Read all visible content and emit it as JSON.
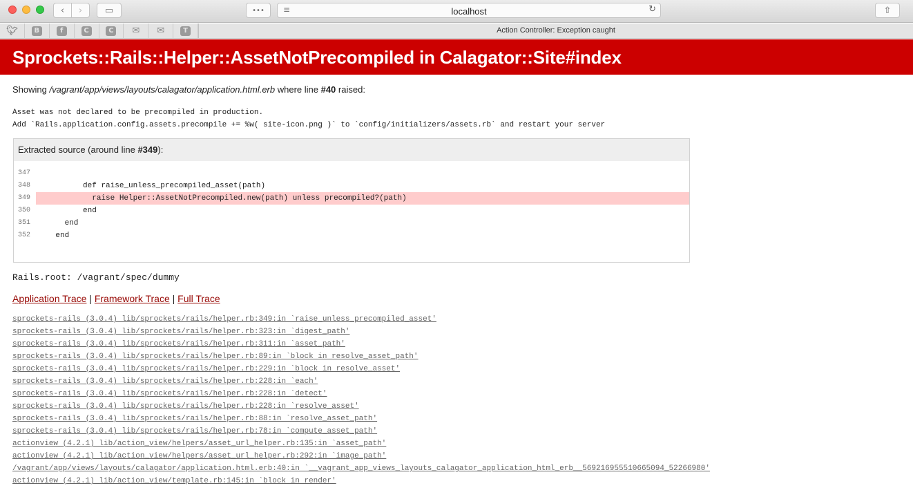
{
  "browser": {
    "address": "localhost",
    "tab_title": "Action Controller: Exception caught",
    "icons": {
      "reader": "≡",
      "reload": "↻",
      "share": "⇧",
      "sidebar": "▭",
      "back": "‹",
      "forward": "›",
      "extensions": "•••"
    },
    "favorites": [
      "twitter",
      "B",
      "f",
      "C",
      "C",
      "mail",
      "mail",
      "T"
    ]
  },
  "error": {
    "title": "Sprockets::Rails::Helper::AssetNotPrecompiled in Calagator::Site#index",
    "showing_prefix": "Showing ",
    "template_path": "/vagrant/app/views/layouts/calagator/application.html.erb",
    "showing_middle": " where line ",
    "line": "#40",
    "showing_suffix": " raised:",
    "message_line1": "Asset was not declared to be precompiled in production.",
    "message_line2": "Add `Rails.application.config.assets.precompile += %w( site-icon.png )` to `config/initializers/assets.rb` and restart your server"
  },
  "source": {
    "header_prefix": "Extracted source (around line ",
    "header_line": "#349",
    "header_suffix": "):",
    "line_numbers": [
      "347",
      "348",
      "349",
      "350",
      "351",
      "352"
    ],
    "code": [
      "",
      "          def raise_unless_precompiled_asset(path)",
      "            raise Helper::AssetNotPrecompiled.new(path) unless precompiled?(path)",
      "          end",
      "      end",
      "    end"
    ],
    "highlight_index": 2
  },
  "rails_root": "Rails.root: /vagrant/spec/dummy",
  "trace_links": {
    "application": "Application Trace",
    "framework": "Framework Trace",
    "full": "Full Trace",
    "separator": " | "
  },
  "trace": [
    "sprockets-rails (3.0.4) lib/sprockets/rails/helper.rb:349:in `raise_unless_precompiled_asset'",
    "sprockets-rails (3.0.4) lib/sprockets/rails/helper.rb:323:in `digest_path'",
    "sprockets-rails (3.0.4) lib/sprockets/rails/helper.rb:311:in `asset_path'",
    "sprockets-rails (3.0.4) lib/sprockets/rails/helper.rb:89:in `block in resolve_asset_path'",
    "sprockets-rails (3.0.4) lib/sprockets/rails/helper.rb:229:in `block in resolve_asset'",
    "sprockets-rails (3.0.4) lib/sprockets/rails/helper.rb:228:in `each'",
    "sprockets-rails (3.0.4) lib/sprockets/rails/helper.rb:228:in `detect'",
    "sprockets-rails (3.0.4) lib/sprockets/rails/helper.rb:228:in `resolve_asset'",
    "sprockets-rails (3.0.4) lib/sprockets/rails/helper.rb:88:in `resolve_asset_path'",
    "sprockets-rails (3.0.4) lib/sprockets/rails/helper.rb:78:in `compute_asset_path'",
    "actionview (4.2.1) lib/action_view/helpers/asset_url_helper.rb:135:in `asset_path'",
    "actionview (4.2.1) lib/action_view/helpers/asset_url_helper.rb:292:in `image_path'",
    "/vagrant/app/views/layouts/calagator/application.html.erb:40:in `__vagrant_app_views_layouts_calagator_application_html_erb__569216955510665094_52266980'",
    "actionview (4.2.1) lib/action_view/template.rb:145:in `block in render'"
  ]
}
